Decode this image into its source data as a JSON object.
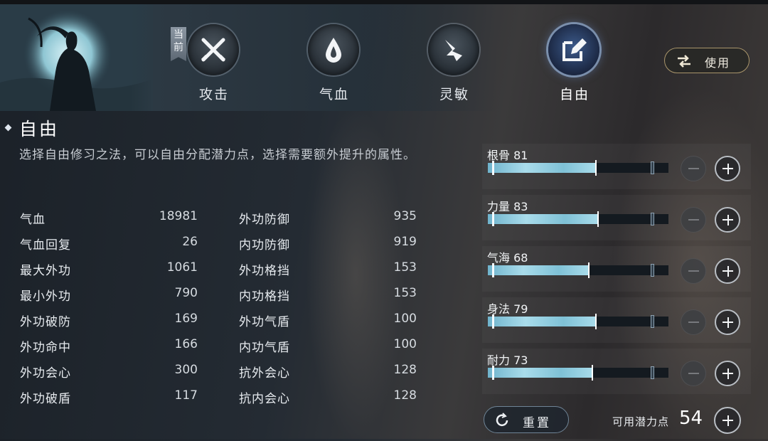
{
  "header": {
    "current_badge": "当前",
    "use_button": "使用",
    "tabs": [
      {
        "label": "攻击",
        "icon": "crossed-swords-icon"
      },
      {
        "label": "气血",
        "icon": "blood-drop-icon"
      },
      {
        "label": "灵敏",
        "icon": "rabbit-icon"
      },
      {
        "label": "自由",
        "icon": "edit-icon"
      }
    ]
  },
  "section": {
    "title": "自由",
    "description": "选择自由修习之法，可以自由分配潜力点，选择需要额外提升的属性。"
  },
  "stats_left": [
    {
      "name": "气血",
      "value": "18981"
    },
    {
      "name": "气血回复",
      "value": "26"
    },
    {
      "name": "最大外功",
      "value": "1061"
    },
    {
      "name": "最小外功",
      "value": "790"
    },
    {
      "name": "外功破防",
      "value": "169"
    },
    {
      "name": "外功命中",
      "value": "166"
    },
    {
      "name": "外功会心",
      "value": "300"
    },
    {
      "name": "外功破盾",
      "value": "117"
    }
  ],
  "stats_right": [
    {
      "name": "外功防御",
      "value": "935"
    },
    {
      "name": "内功防御",
      "value": "919"
    },
    {
      "name": "外功格挡",
      "value": "153"
    },
    {
      "name": "内功格挡",
      "value": "153"
    },
    {
      "name": "外功气盾",
      "value": "100"
    },
    {
      "name": "内功气盾",
      "value": "100"
    },
    {
      "name": "抗外会心",
      "value": "128"
    },
    {
      "name": "抗内会心",
      "value": "128"
    }
  ],
  "attributes": [
    {
      "label": "根骨 81",
      "fill": 0.6
    },
    {
      "label": "力量 83",
      "fill": 0.61
    },
    {
      "label": "气海 68",
      "fill": 0.56
    },
    {
      "label": "身法 79",
      "fill": 0.6
    },
    {
      "label": "耐力 73",
      "fill": 0.58
    }
  ],
  "footer": {
    "reset_button": "重置",
    "points_label": "可用潜力点",
    "points_value": "54"
  },
  "colors": {
    "bar_fill": "#a9dceb",
    "active_tab": "#3c5a8a",
    "use_button_border": "#a9956b"
  }
}
